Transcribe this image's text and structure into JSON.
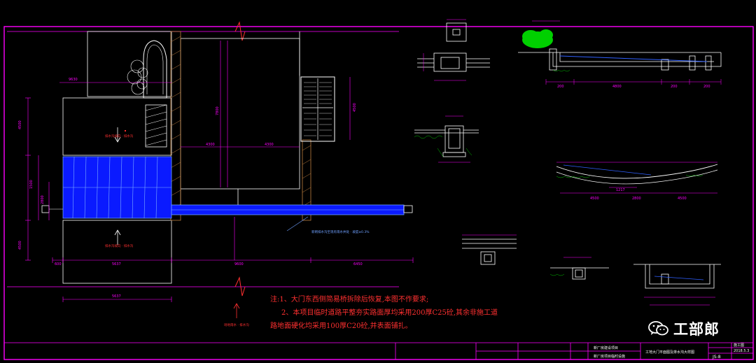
{
  "notes": {
    "line1": "注:1、大门东西侧简易桥拆除后恢复,本图不作要求;",
    "line2": "2、本项目临时道路平整夯实路面厚均采用200厚C25砼,其余非施工道",
    "line3": "路地面硬化均采用100厚C20砼,并表面铺扎。"
  },
  "watermark": {
    "text": "工部郎",
    "icon": "wechat-icon"
  },
  "title_block": {
    "project_line1": "新厂房建设项目",
    "project_line2": "新厂房项目临时设施",
    "drawing_title": "工地大门平面图及排水沟大样图",
    "code": "施工图",
    "date": "2018.5.3",
    "sheet": "JS-8"
  },
  "labels": {
    "plan_dims": [
      "4500",
      "1500",
      "2800",
      "1500",
      "4500"
    ],
    "bottom_dims": [
      "600",
      "5637",
      "9600",
      "6450"
    ],
    "callout": "新砌排水沟至现有雨水井处 · 坡度≥0.3%",
    "arrow_text_upper": "排水沟坡向 · 排水沟",
    "arrow_text_lower": "排水沟坡向 · 排水沟",
    "arrow_text_red": "场地雨水 · 排水沟"
  },
  "colors": {
    "background": "#000000",
    "frame": "#ff00ff",
    "lines": "#ffffff",
    "dimension": "#ff00ff",
    "water": "#0000ff",
    "vegetation": "#00ff00",
    "notes": "#ff3030"
  }
}
